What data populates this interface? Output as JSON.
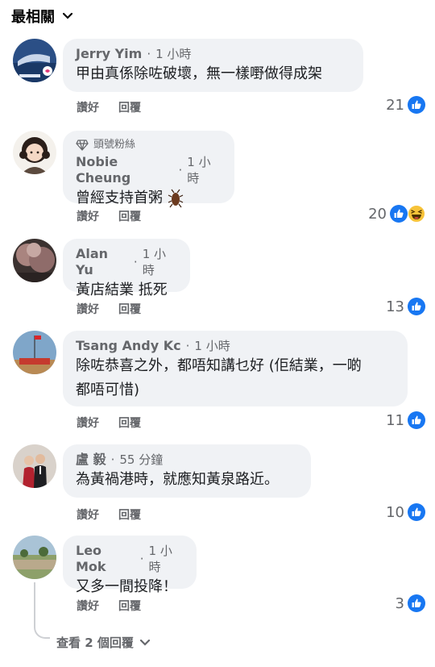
{
  "sort": {
    "label": "最相關"
  },
  "comments": [
    {
      "author": "Jerry Yim",
      "time": "1 小時",
      "text": "甲由真係除咗破壞，無一樣嘢做得成架",
      "like_label": "讚好",
      "reply_label": "回覆",
      "reaction_count": "21",
      "reactions": [
        "like-icon"
      ]
    },
    {
      "badge": "頭號粉絲",
      "author": "Nobie Cheung",
      "time": "1 小時",
      "text": "曾經支持首粥",
      "like_label": "讚好",
      "reply_label": "回覆",
      "reaction_count": "20",
      "reactions": [
        "like-icon",
        "haha-icon"
      ]
    },
    {
      "author": "Alan Yu",
      "time": "1 小時",
      "text": "黃店結業 抵死",
      "like_label": "讚好",
      "reply_label": "回覆",
      "reaction_count": "13",
      "reactions": [
        "like-icon"
      ]
    },
    {
      "author": "Tsang Andy Kc",
      "time": "1 小時",
      "text_line1": "除咗恭喜之外，都唔知講乜好 (佢結業，一啲",
      "text_line2": "都唔可惜)",
      "like_label": "讚好",
      "reply_label": "回覆",
      "reaction_count": "11",
      "reactions": [
        "like-icon"
      ]
    },
    {
      "author": "盧 毅",
      "time": "55 分鐘",
      "text": "為黃禍港時，就應知黃泉路近。",
      "like_label": "讚好",
      "reply_label": "回覆",
      "reaction_count": "10",
      "reactions": [
        "like-icon"
      ]
    },
    {
      "author": "Leo Mok",
      "time": "1 小時",
      "text": "又多一間投降！",
      "like_label": "讚好",
      "reply_label": "回覆",
      "reaction_count": "3",
      "reactions": [
        "like-icon"
      ]
    }
  ],
  "view_replies": {
    "label": "查看 2 個回覆"
  },
  "colors": {
    "like_blue": "#1877f2",
    "bubble": "#f0f2f5",
    "secondary_text": "#65676b"
  }
}
